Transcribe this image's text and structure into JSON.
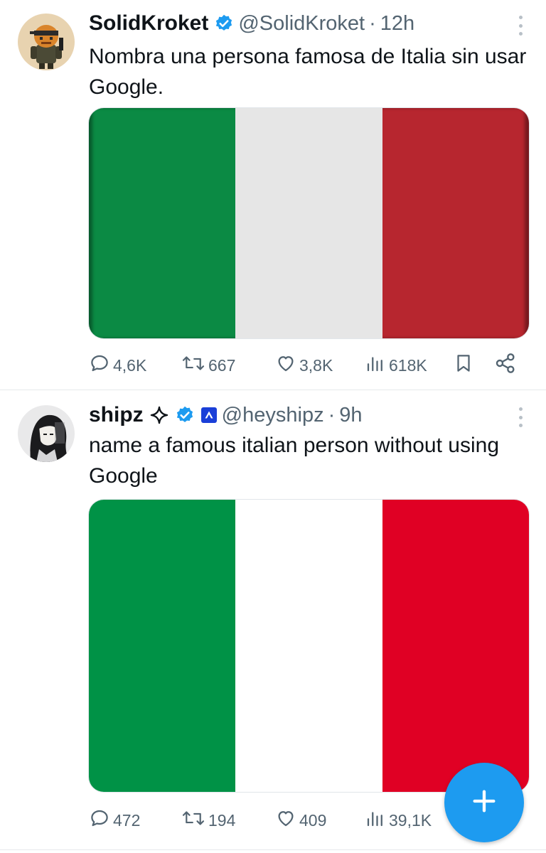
{
  "tweets": [
    {
      "name": "SolidKroket",
      "handle": "@SolidKroket",
      "time": "12h",
      "text": "Nombra una persona famosa de Italia sin usar Google.",
      "flag_colors": [
        "#0b8a44",
        "#e6e6e6",
        "#b7262f"
      ],
      "replies": "4,6K",
      "reposts": "667",
      "likes": "3,8K",
      "views": "618K"
    },
    {
      "name": "shipz",
      "handle": "@heyshipz",
      "time": "9h",
      "text": "name a famous italian person without using Google",
      "flag_colors": [
        "#009246",
        "#ffffff",
        "#e00024"
      ],
      "replies": "472",
      "reposts": "194",
      "likes": "409",
      "views": "39,1K"
    }
  ],
  "icons": {
    "verified": "verified-badge-icon",
    "sparkle": "sparkle-icon",
    "affiliate": "affiliate-badge-icon",
    "more": "more-options-icon",
    "reply": "reply-icon",
    "repost": "repost-icon",
    "like": "like-icon",
    "views": "views-icon",
    "bookmark": "bookmark-icon",
    "share": "share-icon",
    "compose": "compose-plus-icon"
  },
  "colors": {
    "accent": "#1d9bf0",
    "secondary_text": "#536471"
  }
}
